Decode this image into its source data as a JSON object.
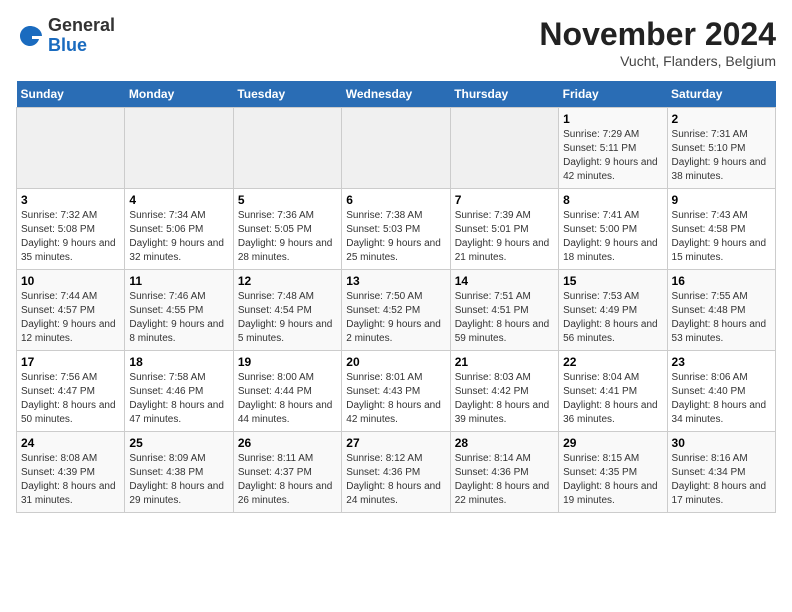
{
  "header": {
    "logo_line1": "General",
    "logo_line2": "Blue",
    "month_title": "November 2024",
    "location": "Vucht, Flanders, Belgium"
  },
  "weekdays": [
    "Sunday",
    "Monday",
    "Tuesday",
    "Wednesday",
    "Thursday",
    "Friday",
    "Saturday"
  ],
  "weeks": [
    [
      {
        "day": "",
        "info": ""
      },
      {
        "day": "",
        "info": ""
      },
      {
        "day": "",
        "info": ""
      },
      {
        "day": "",
        "info": ""
      },
      {
        "day": "",
        "info": ""
      },
      {
        "day": "1",
        "info": "Sunrise: 7:29 AM\nSunset: 5:11 PM\nDaylight: 9 hours\nand 42 minutes."
      },
      {
        "day": "2",
        "info": "Sunrise: 7:31 AM\nSunset: 5:10 PM\nDaylight: 9 hours\nand 38 minutes."
      }
    ],
    [
      {
        "day": "3",
        "info": "Sunrise: 7:32 AM\nSunset: 5:08 PM\nDaylight: 9 hours\nand 35 minutes."
      },
      {
        "day": "4",
        "info": "Sunrise: 7:34 AM\nSunset: 5:06 PM\nDaylight: 9 hours\nand 32 minutes."
      },
      {
        "day": "5",
        "info": "Sunrise: 7:36 AM\nSunset: 5:05 PM\nDaylight: 9 hours\nand 28 minutes."
      },
      {
        "day": "6",
        "info": "Sunrise: 7:38 AM\nSunset: 5:03 PM\nDaylight: 9 hours\nand 25 minutes."
      },
      {
        "day": "7",
        "info": "Sunrise: 7:39 AM\nSunset: 5:01 PM\nDaylight: 9 hours\nand 21 minutes."
      },
      {
        "day": "8",
        "info": "Sunrise: 7:41 AM\nSunset: 5:00 PM\nDaylight: 9 hours\nand 18 minutes."
      },
      {
        "day": "9",
        "info": "Sunrise: 7:43 AM\nSunset: 4:58 PM\nDaylight: 9 hours\nand 15 minutes."
      }
    ],
    [
      {
        "day": "10",
        "info": "Sunrise: 7:44 AM\nSunset: 4:57 PM\nDaylight: 9 hours\nand 12 minutes."
      },
      {
        "day": "11",
        "info": "Sunrise: 7:46 AM\nSunset: 4:55 PM\nDaylight: 9 hours\nand 8 minutes."
      },
      {
        "day": "12",
        "info": "Sunrise: 7:48 AM\nSunset: 4:54 PM\nDaylight: 9 hours\nand 5 minutes."
      },
      {
        "day": "13",
        "info": "Sunrise: 7:50 AM\nSunset: 4:52 PM\nDaylight: 9 hours\nand 2 minutes."
      },
      {
        "day": "14",
        "info": "Sunrise: 7:51 AM\nSunset: 4:51 PM\nDaylight: 8 hours\nand 59 minutes."
      },
      {
        "day": "15",
        "info": "Sunrise: 7:53 AM\nSunset: 4:49 PM\nDaylight: 8 hours\nand 56 minutes."
      },
      {
        "day": "16",
        "info": "Sunrise: 7:55 AM\nSunset: 4:48 PM\nDaylight: 8 hours\nand 53 minutes."
      }
    ],
    [
      {
        "day": "17",
        "info": "Sunrise: 7:56 AM\nSunset: 4:47 PM\nDaylight: 8 hours\nand 50 minutes."
      },
      {
        "day": "18",
        "info": "Sunrise: 7:58 AM\nSunset: 4:46 PM\nDaylight: 8 hours\nand 47 minutes."
      },
      {
        "day": "19",
        "info": "Sunrise: 8:00 AM\nSunset: 4:44 PM\nDaylight: 8 hours\nand 44 minutes."
      },
      {
        "day": "20",
        "info": "Sunrise: 8:01 AM\nSunset: 4:43 PM\nDaylight: 8 hours\nand 42 minutes."
      },
      {
        "day": "21",
        "info": "Sunrise: 8:03 AM\nSunset: 4:42 PM\nDaylight: 8 hours\nand 39 minutes."
      },
      {
        "day": "22",
        "info": "Sunrise: 8:04 AM\nSunset: 4:41 PM\nDaylight: 8 hours\nand 36 minutes."
      },
      {
        "day": "23",
        "info": "Sunrise: 8:06 AM\nSunset: 4:40 PM\nDaylight: 8 hours\nand 34 minutes."
      }
    ],
    [
      {
        "day": "24",
        "info": "Sunrise: 8:08 AM\nSunset: 4:39 PM\nDaylight: 8 hours\nand 31 minutes."
      },
      {
        "day": "25",
        "info": "Sunrise: 8:09 AM\nSunset: 4:38 PM\nDaylight: 8 hours\nand 29 minutes."
      },
      {
        "day": "26",
        "info": "Sunrise: 8:11 AM\nSunset: 4:37 PM\nDaylight: 8 hours\nand 26 minutes."
      },
      {
        "day": "27",
        "info": "Sunrise: 8:12 AM\nSunset: 4:36 PM\nDaylight: 8 hours\nand 24 minutes."
      },
      {
        "day": "28",
        "info": "Sunrise: 8:14 AM\nSunset: 4:36 PM\nDaylight: 8 hours\nand 22 minutes."
      },
      {
        "day": "29",
        "info": "Sunrise: 8:15 AM\nSunset: 4:35 PM\nDaylight: 8 hours\nand 19 minutes."
      },
      {
        "day": "30",
        "info": "Sunrise: 8:16 AM\nSunset: 4:34 PM\nDaylight: 8 hours\nand 17 minutes."
      }
    ]
  ]
}
